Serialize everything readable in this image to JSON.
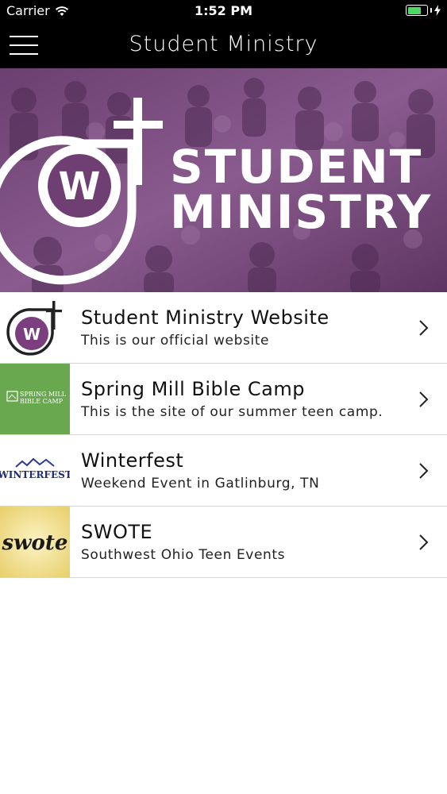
{
  "status_bar": {
    "carrier": "Carrier",
    "time": "1:52 PM",
    "battery_level": 0.7
  },
  "nav": {
    "title": "Student Ministry",
    "menu_icon": "hamburger-menu-icon"
  },
  "banner": {
    "line1": "STUDENT",
    "line2": "MINISTRY",
    "logo_letter": "W",
    "overlay_color": "#7d4b82"
  },
  "items": [
    {
      "title": "Student Ministry Website",
      "subtitle": "This is our official website",
      "thumb_letter": "W"
    },
    {
      "title": "Spring Mill Bible Camp",
      "subtitle": "This is the site of our summer teen camp.",
      "thumb_text_line1": "SPRING MILL",
      "thumb_text_line2": "BIBLE CAMP",
      "thumb_color": "#6aa84f"
    },
    {
      "title": "Winterfest",
      "subtitle": "Weekend Event in Gatlinburg, TN",
      "thumb_text": "WINTERFEST"
    },
    {
      "title": "SWOTE",
      "subtitle": "Southwest Ohio Teen Events",
      "thumb_text": "swote"
    }
  ]
}
